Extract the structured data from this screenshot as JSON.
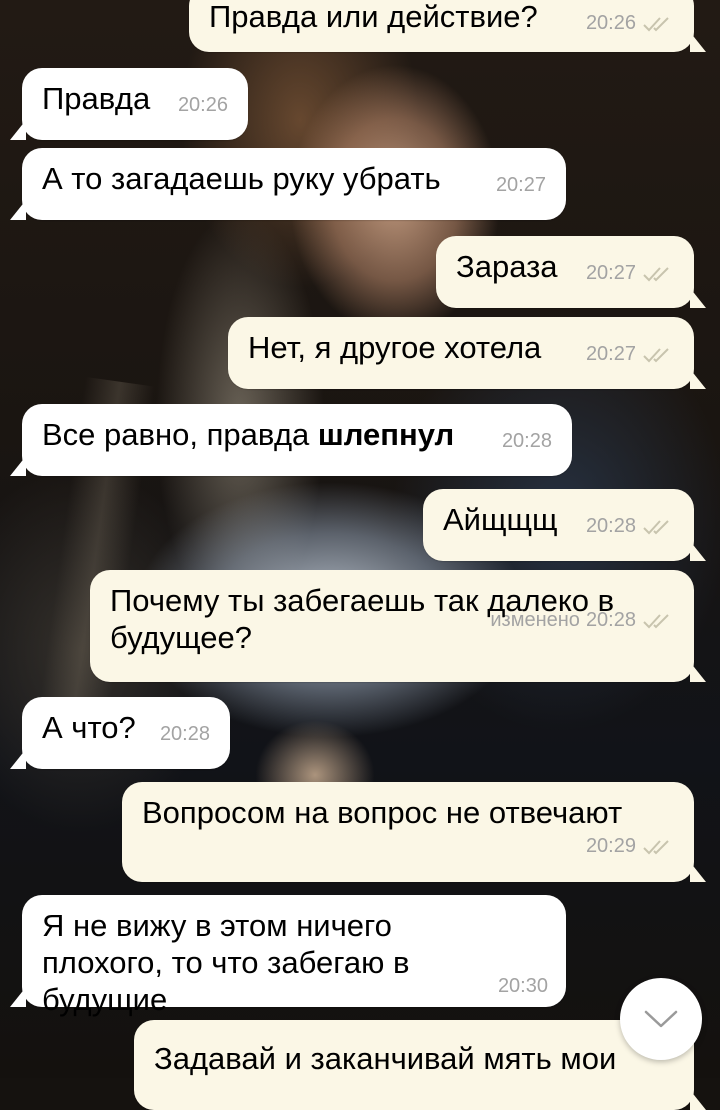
{
  "chat": {
    "messages": [
      {
        "direction": "out",
        "text": "Правда или действие?",
        "time": "20:26",
        "status": "read"
      },
      {
        "direction": "in",
        "text": "Правда",
        "time": "20:26"
      },
      {
        "direction": "in",
        "text": "А то загадаешь руку убрать",
        "time": "20:27"
      },
      {
        "direction": "out",
        "text": "Зараза",
        "time": "20:27",
        "status": "read"
      },
      {
        "direction": "out",
        "text": "Нет, я другое хотела",
        "time": "20:27",
        "status": "read"
      },
      {
        "direction": "in",
        "text": "Все равно, правда ",
        "bold_text": "шлепнул",
        "time": "20:28"
      },
      {
        "direction": "out",
        "text": "Айщщщ",
        "time": "20:28",
        "status": "read"
      },
      {
        "direction": "out",
        "text": "Почему ты забегаешь так далеко в будущее?",
        "edited_label": "изменено",
        "time": "20:28",
        "status": "read"
      },
      {
        "direction": "in",
        "text": "А что?",
        "time": "20:28"
      },
      {
        "direction": "out",
        "text": "Вопросом на вопрос не отвечают",
        "time": "20:29",
        "status": "read"
      },
      {
        "direction": "in",
        "text": "Я не вижу в этом ничего плохого, то что забегаю в будущие",
        "time": "20:30"
      },
      {
        "direction": "out",
        "text": "Задавай и заканчивай мять мои",
        "time": "",
        "status": ""
      }
    ]
  },
  "ui": {
    "scroll_down_icon": "chevron-down-icon",
    "read_ticks_icon": "double-check-icon",
    "colors": {
      "incoming_bubble": "#ffffff",
      "outgoing_bubble": "#fbf7e6",
      "meta_text": "#a3a3a3",
      "read_ticks": "#c8c4ae"
    }
  }
}
